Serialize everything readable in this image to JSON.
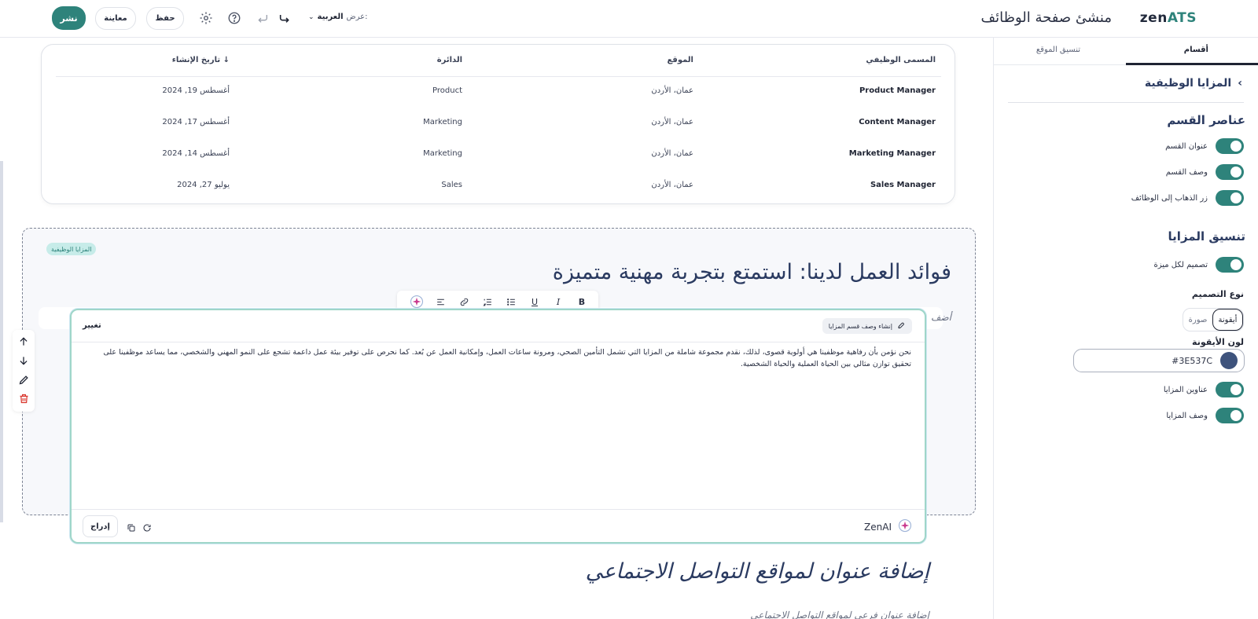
{
  "topbar": {
    "publish_label": "نشر",
    "preview_label": "معاينة",
    "save_label": "حفظ",
    "view_label": "عرض:",
    "language_value": "العربية",
    "app_title": "منشئ صفحة الوظائف",
    "logo_zen": "zen",
    "logo_ats": "ATS"
  },
  "right_panel": {
    "tabs": [
      "أقسام",
      "تنسيق الموقع"
    ],
    "section_back_title": "المزايا الوظيفية",
    "section_elements_heading": "عناصر القسم",
    "section_toggles": [
      "عنوان القسم",
      "وصف القسم",
      "زر الذهاب إلى الوظائف"
    ],
    "benefits_format_heading": "تنسيق المزايا",
    "per_feature_design_label": "تصميم لكل ميزة",
    "design_type_heading": "نوع التصميم",
    "design_type_options": [
      "أيقونة",
      "صورة"
    ],
    "icon_color_heading": "لون الأيقونة",
    "icon_color_value": "#3E537C",
    "benefit_toggles": [
      "عناوين المزايا",
      "وصف المزايا"
    ]
  },
  "jobs_table": {
    "columns": [
      "المسمى الوظيفي",
      "الموقع",
      "الدائرة",
      "تاريخ الإنشاء ↓"
    ],
    "rows": [
      [
        "Product Manager",
        "عمان، الأردن",
        "Product",
        "أغسطس 19, 2024"
      ],
      [
        "Content Manager",
        "عمان، الأردن",
        "Marketing",
        "أغسطس 17, 2024"
      ],
      [
        "Marketing Manager",
        "عمان، الأردن",
        "Marketing",
        "أغسطس 14, 2024"
      ],
      [
        "Sales Manager",
        "عمان، الأردن",
        "Sales",
        "يوليو 27, 2024"
      ]
    ]
  },
  "benefits_section": {
    "badge": "المزايا الوظيفية",
    "title": "فوائد العمل لدينا: استمتع بتجربة مهنية متميزة",
    "ghost_placeholder": "أضف"
  },
  "format_toolbar": {
    "bold": "B",
    "italic": "I",
    "underline": "U"
  },
  "ai_editor": {
    "change_label": "تغيير",
    "generate_chip": "إنشاء وصف قسم المزايا",
    "body_text": "نحن نؤمن بأن رفاهية موظفينا هي أولوية قصوى، لذلك، نقدم مجموعة شاملة من المزايا التي تشمل التأمين الصحي، ومرونة ساعات العمل، وإمكانية العمل عن بُعد. كما نحرص على توفير بيئة عمل داعمة تشجع على النمو المهني والشخصي، مما يساعد موظفينا على تحقيق توازن مثالي بين الحياة العملية والحياة الشخصية.",
    "insert_label": "إدراج",
    "brand": "ZenAI"
  },
  "social_section": {
    "title": "إضافة عنوان لمواقع التواصل الاجتماعي",
    "subtitle": "إضافة عنوان فرعي لمواقع التواصل الاجتماعي"
  },
  "colors": {
    "accent": "#2e837b",
    "heading": "#2b3b61",
    "danger": "#d9342b"
  }
}
